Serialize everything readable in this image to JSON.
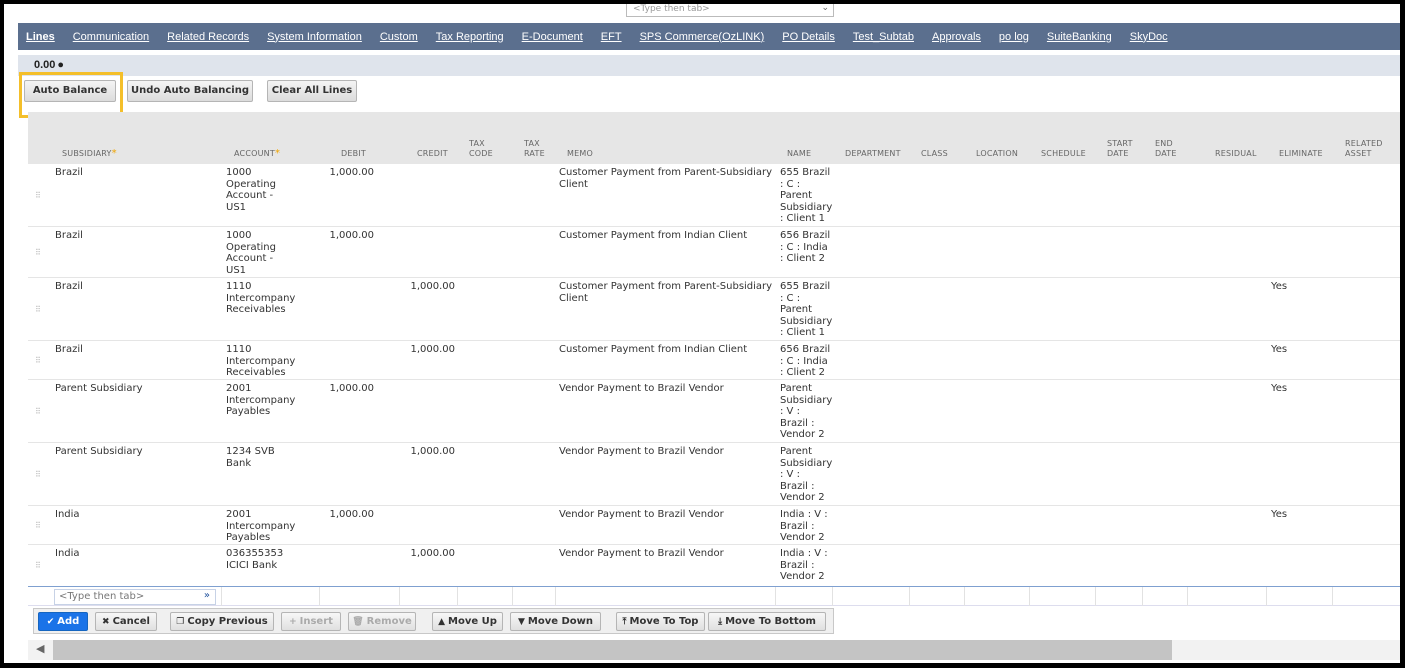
{
  "top_select": {
    "placeholder": "<Type then tab>"
  },
  "tabs": [
    {
      "label": "Lines",
      "active": true
    },
    {
      "label": "Communication"
    },
    {
      "label": "Related Records"
    },
    {
      "label": "System Information"
    },
    {
      "label": "Custom"
    },
    {
      "label": "Tax Reporting"
    },
    {
      "label": "E-Document"
    },
    {
      "label": "EFT"
    },
    {
      "label": "SPS Commerce(OzLINK)"
    },
    {
      "label": "PO Details"
    },
    {
      "label": "Test_Subtab"
    },
    {
      "label": "Approvals"
    },
    {
      "label": "po log"
    },
    {
      "label": "SuiteBanking"
    },
    {
      "label": "SkyDoc"
    }
  ],
  "total": {
    "value": "0.00",
    "marker": "●"
  },
  "actions": {
    "auto_balance": "Auto Balance",
    "undo_auto_balancing": "Undo Auto Balancing",
    "clear_all_lines": "Clear All Lines"
  },
  "highlight_color": "#f4bf2a",
  "tab_bar_color": "#5b6f8e",
  "columns": {
    "subsidiary": "SUBSIDIARY",
    "account": "ACCOUNT",
    "debit": "DEBIT",
    "credit": "CREDIT",
    "tax_code": [
      "TAX",
      "CODE"
    ],
    "tax_rate": [
      "TAX",
      "RATE"
    ],
    "memo": "MEMO",
    "name": "NAME",
    "department": "DEPARTMENT",
    "class": "CLASS",
    "location": "LOCATION",
    "schedule": "SCHEDULE",
    "start_date": [
      "START",
      "DATE"
    ],
    "end_date": [
      "END",
      "DATE"
    ],
    "residual": "RESIDUAL",
    "eliminate": "ELIMINATE",
    "related_asset": [
      "RELATED",
      "ASSET"
    ]
  },
  "required_marker": "*",
  "rows": [
    {
      "subsidiary": "Brazil",
      "account": [
        "1000",
        "Operating",
        "Account -",
        "US1"
      ],
      "debit": "1,000.00",
      "credit": "",
      "memo": [
        "Customer Payment from Parent-Subsidiary",
        "Client"
      ],
      "name": [
        "655 Brazil",
        ": C :",
        "Parent",
        "Subsidiary",
        ": Client 1"
      ],
      "eliminate": ""
    },
    {
      "subsidiary": "Brazil",
      "account": [
        "1000",
        "Operating",
        "Account -",
        "US1"
      ],
      "debit": "1,000.00",
      "credit": "",
      "memo": [
        "Customer Payment from Indian Client"
      ],
      "name": [
        "656 Brazil",
        ": C : India",
        ": Client 2"
      ],
      "eliminate": ""
    },
    {
      "subsidiary": "Brazil",
      "account": [
        "1110",
        "Intercompany",
        "Receivables"
      ],
      "debit": "",
      "credit": "1,000.00",
      "memo": [
        "Customer Payment from Parent-Subsidiary",
        "Client"
      ],
      "name": [
        "655 Brazil",
        ": C :",
        "Parent",
        "Subsidiary",
        ": Client 1"
      ],
      "eliminate": "Yes"
    },
    {
      "subsidiary": "Brazil",
      "account": [
        "1110",
        "Intercompany",
        "Receivables"
      ],
      "debit": "",
      "credit": "1,000.00",
      "memo": [
        "Customer Payment from Indian Client"
      ],
      "name": [
        "656 Brazil",
        ": C : India",
        ": Client 2"
      ],
      "eliminate": "Yes"
    },
    {
      "subsidiary": "Parent Subsidiary",
      "account": [
        "2001",
        "Intercompany",
        "Payables"
      ],
      "debit": "1,000.00",
      "credit": "",
      "memo": [
        "Vendor Payment to Brazil Vendor"
      ],
      "name": [
        "Parent",
        "Subsidiary",
        ": V :",
        "Brazil :",
        "Vendor 2"
      ],
      "eliminate": "Yes"
    },
    {
      "subsidiary": "Parent Subsidiary",
      "account": [
        "1234 SVB",
        "Bank"
      ],
      "debit": "",
      "credit": "1,000.00",
      "memo": [
        "Vendor Payment to Brazil Vendor"
      ],
      "name": [
        "Parent",
        "Subsidiary",
        ": V :",
        "Brazil :",
        "Vendor 2"
      ],
      "eliminate": ""
    },
    {
      "subsidiary": "India",
      "account": [
        "2001",
        "Intercompany",
        "Payables"
      ],
      "debit": "1,000.00",
      "credit": "",
      "memo": [
        "Vendor Payment to Brazil Vendor"
      ],
      "name": [
        "India : V :",
        "Brazil :",
        "Vendor 2"
      ],
      "eliminate": "Yes"
    },
    {
      "subsidiary": "India",
      "account": [
        "036355353",
        "ICICI Bank"
      ],
      "debit": "",
      "credit": "1,000.00",
      "memo": [
        "Vendor Payment to Brazil Vendor"
      ],
      "name": [
        "India : V :",
        "Brazil :",
        "Vendor 2"
      ],
      "eliminate": ""
    }
  ],
  "entry_row": {
    "placeholder": "<Type then tab>"
  },
  "line_buttons": [
    {
      "label": "Add",
      "icon": "✔",
      "icon_name": "check-icon",
      "kind": "primary"
    },
    {
      "label": "Cancel",
      "icon": "✖",
      "icon_name": "x-icon"
    },
    {
      "label": "Copy Previous",
      "icon": "❐",
      "icon_name": "copy-icon"
    },
    {
      "label": "Insert",
      "icon": "+",
      "icon_name": "plus-icon",
      "kind": "disabled"
    },
    {
      "label": "Remove",
      "icon": "🗑",
      "icon_name": "trash-icon",
      "kind": "disabled"
    },
    {
      "label": "Move Up",
      "icon": "▲",
      "icon_name": "arrow-up-icon"
    },
    {
      "label": "Move Down",
      "icon": "▼",
      "icon_name": "arrow-down-icon"
    },
    {
      "label": "Move To Top",
      "icon": "⤒",
      "icon_name": "arrow-top-icon"
    },
    {
      "label": "Move To Bottom",
      "icon": "⤓",
      "icon_name": "arrow-bottom-icon"
    }
  ]
}
